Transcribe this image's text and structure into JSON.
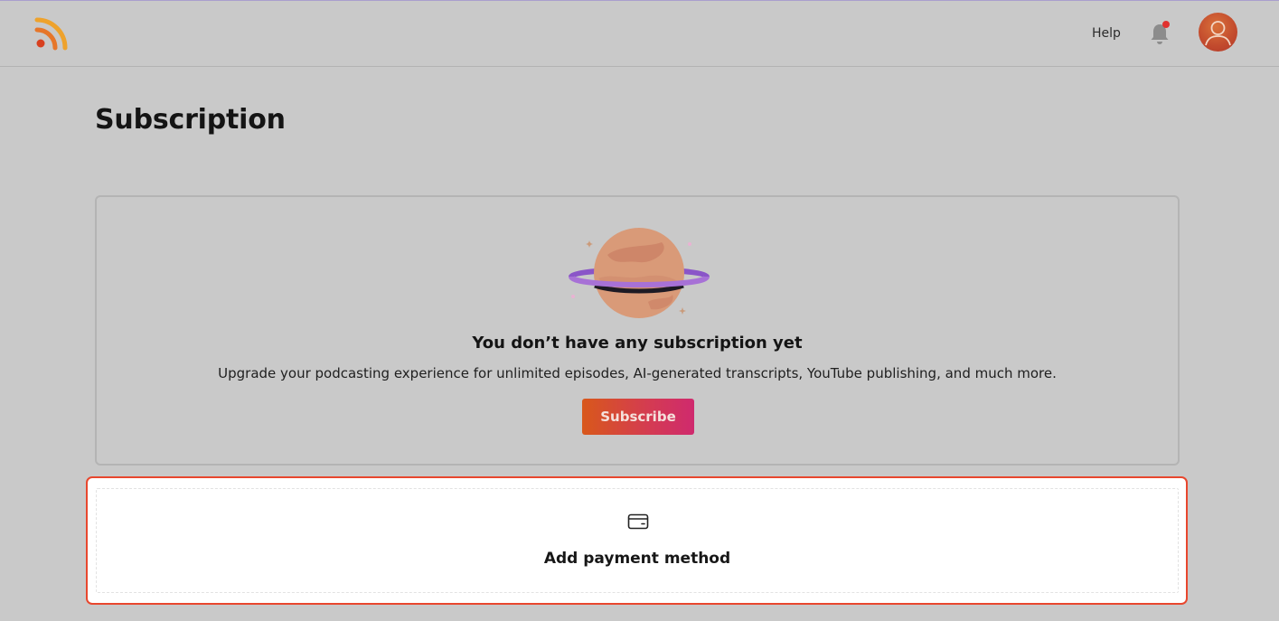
{
  "header": {
    "logo_icon": "rss-feed-logo-icon",
    "help_label": "Help",
    "notification_icon": "bell-icon",
    "avatar_icon": "user-avatar-icon"
  },
  "page": {
    "title": "Subscription"
  },
  "subscription_card": {
    "illustration": "planet-illustration",
    "heading": "You don’t have any subscription yet",
    "description": "Upgrade your podcasting experience for unlimited episodes, AI-generated transcripts, YouTube publishing, and much more.",
    "subscribe_label": "Subscribe"
  },
  "payment": {
    "icon": "credit-card-icon",
    "add_label": "Add payment method"
  },
  "colors": {
    "background": "#c9c9c9",
    "highlight_border": "#e8472e",
    "subscribe_gradient_start": "#d8581b",
    "subscribe_gradient_end": "#cf2a6e",
    "notification_dot": "#e0312f",
    "logo_orange": "#e8892a",
    "logo_red": "#d8401f"
  }
}
